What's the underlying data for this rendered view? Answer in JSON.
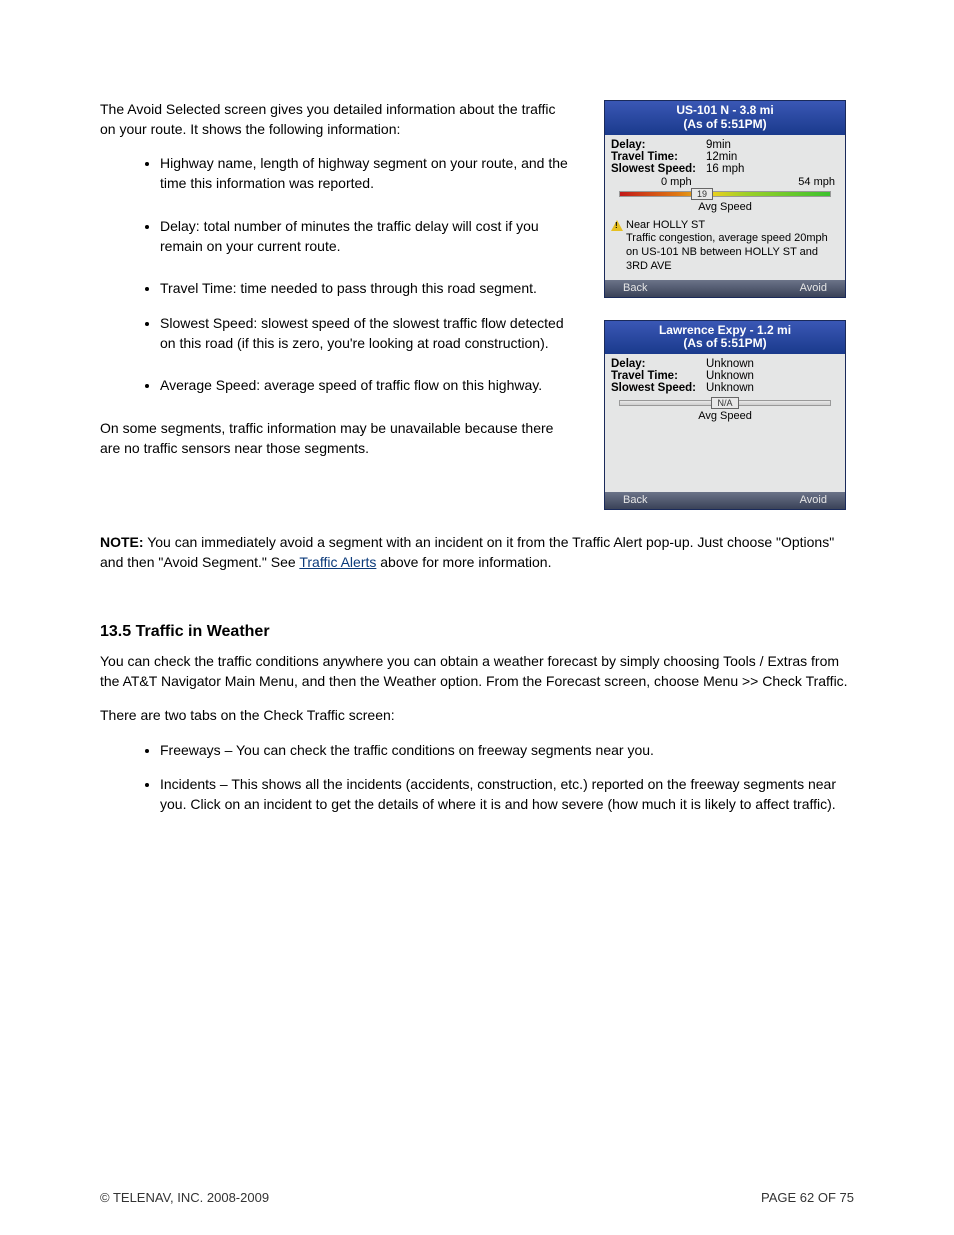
{
  "intro": "The Avoid Selected screen gives you detailed information about the traffic on your route. It shows the following information:",
  "bullets": [
    "Highway name, length of highway segment on your route, and the time this information was reported.",
    "Delay: total number of minutes the traffic delay will cost if you remain on your current route.",
    "Travel Time: time needed to pass through this road segment.",
    "Slowest Speed: slowest speed of the slowest traffic flow detected on this road (if this is zero, you're looking at road construction).",
    "Average Speed: average speed of traffic flow on this highway."
  ],
  "after_bullets": "On some segments, traffic information may be unavailable because there are no traffic sensors near those segments.",
  "note_label": "NOTE:",
  "note_text_pre": "You can immediately avoid a segment with an incident on it from the Traffic Alert pop-up. Just choose \"Options\" and then \"Avoid Segment.\" See ",
  "note_link": "Traffic Alerts",
  "note_text_post": " above for more information.",
  "section2_title": "13.5 Traffic in Weather",
  "section2_body": "You can check the traffic conditions anywhere you can obtain a weather forecast by simply choosing Tools / Extras from the AT&T Navigator Main Menu, and then the Weather option. From the Forecast screen, choose Menu >> Check Traffic.",
  "section2_body2": "There are two tabs on the Check Traffic screen:",
  "traffic_tabs": [
    "Freeways – You can check the traffic conditions on freeway segments near you.",
    "Incidents – This shows all the incidents (accidents, construction, etc.) reported on the freeway segments near you. Click on an incident to get the details of where it is and how severe (how much it is likely to affect traffic)."
  ],
  "screen1": {
    "header_line1": "US-101 N - 3.8 mi",
    "header_line2": "(As of 5:51PM)",
    "delay_label": "Delay:",
    "delay_value": "9min",
    "travel_label": "Travel Time:",
    "travel_value": "12min",
    "slowest_label": "Slowest Speed:",
    "slowest_value": "16 mph",
    "range_low": "0 mph",
    "range_high": "54 mph",
    "marker_value": "19",
    "avg_label": "Avg Speed",
    "incident_line1": "Near HOLLY ST",
    "incident_line2": "Traffic congestion, average speed 20mph on US-101 NB between HOLLY ST and 3RD AVE",
    "back": "Back",
    "avoid": "Avoid"
  },
  "screen2": {
    "header_line1": "Lawrence Expy - 1.2 mi",
    "header_line2": "(As of 5:51PM)",
    "delay_label": "Delay:",
    "delay_value": "Unknown",
    "travel_label": "Travel Time:",
    "travel_value": "Unknown",
    "slowest_label": "Slowest Speed:",
    "slowest_value": "Unknown",
    "marker_value": "N/A",
    "avg_label": "Avg Speed",
    "back": "Back",
    "avoid": "Avoid"
  },
  "footer_left": "© TELENAV, INC. 2008-2009",
  "footer_right": "PAGE 62 OF 75"
}
